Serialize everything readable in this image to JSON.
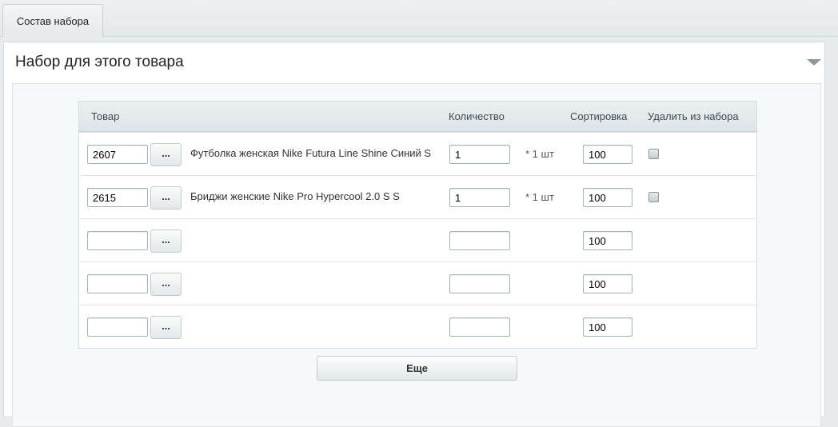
{
  "tabs": [
    {
      "label": "Состав набора"
    }
  ],
  "panel": {
    "title": "Набор для этого товара"
  },
  "table": {
    "headers": {
      "product": "Товар",
      "quantity": "Количество",
      "sort": "Сортировка",
      "remove": "Удалить из набора"
    },
    "browse_label": "...",
    "rows": [
      {
        "id": "2607",
        "name": "Футболка женская Nike Futura Line Shine Синий S",
        "quantity": "1",
        "unit": "* 1 шт",
        "sort": "100",
        "remove_checked": false
      },
      {
        "id": "2615",
        "name": "Бриджи женские Nike Pro Hypercool 2.0 S S",
        "quantity": "1",
        "unit": "* 1 шт",
        "sort": "100",
        "remove_checked": false
      },
      {
        "id": "",
        "name": "",
        "quantity": "",
        "unit": "",
        "sort": "100"
      },
      {
        "id": "",
        "name": "",
        "quantity": "",
        "unit": "",
        "sort": "100"
      },
      {
        "id": "",
        "name": "",
        "quantity": "",
        "unit": "",
        "sort": "100"
      }
    ]
  },
  "more_button": {
    "label": "Еще"
  }
}
